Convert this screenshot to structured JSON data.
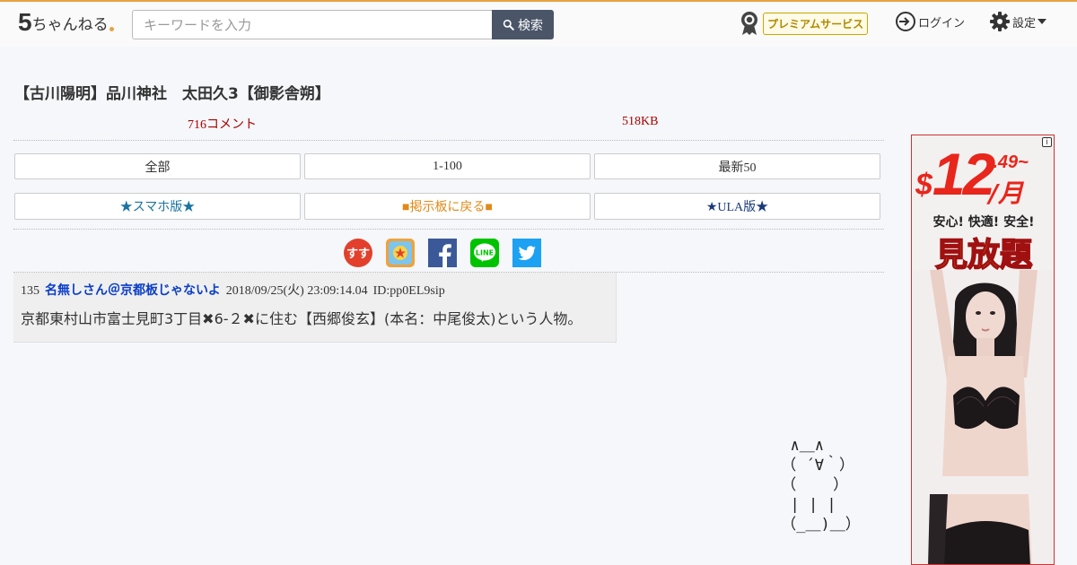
{
  "header": {
    "logo_five": "5",
    "logo_rest": "ちゃんねる",
    "search_placeholder": "キーワードを入力",
    "search_button": "検索",
    "premium_label": "プレミアムサービス",
    "login_label": "ログイン",
    "settings_label": "設定"
  },
  "thread": {
    "title": "【古川陽明】品川神社　太田久3【御影舎朔】",
    "comments": "716コメント",
    "size": "518KB"
  },
  "nav": {
    "row1": [
      "全部",
      "1-100",
      "最新50"
    ],
    "row2": [
      "★スマホ版★",
      "■掲示板に戻る■",
      "★ULA版★"
    ]
  },
  "social": [
    "sumaho-icon",
    "kaedeli-icon",
    "facebook-icon",
    "line-icon",
    "twitter-icon"
  ],
  "social_text": {
    "s1": "すす",
    "line": "LINE"
  },
  "post": {
    "number": "135",
    "name": "名無しさん＠京都板じゃないよ",
    "date": "2018/09/25(火) 23:09:14.04",
    "id": "ID:pp0EL9sip",
    "body": "京都東村山市富士見町3丁目✖6-２✖に住む【西郷俊玄】(本名：中尾俊太)という人物。"
  },
  "ascii_art": "  ∧＿∧\n （ ´∀｀）\n （    ）\n  | | |\n （_＿)＿）",
  "ad": {
    "currency": "$",
    "price": "12",
    "decimal": ".49~",
    "per": "/月",
    "line1": "安心! 快適! 安全!",
    "line2": "見放題",
    "info": "i"
  },
  "colors": {
    "accent": "#e8a240",
    "link": "#0b3ec8",
    "meta": "#aa0000",
    "ad_red": "#e8261b"
  }
}
